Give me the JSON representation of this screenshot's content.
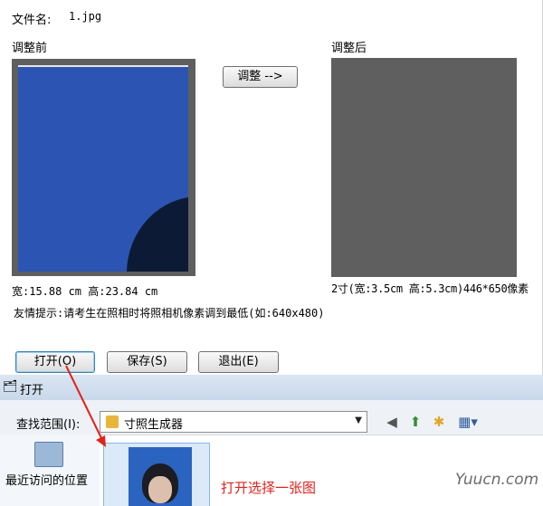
{
  "main": {
    "filename_label": "文件名:",
    "filename_value": "1.jpg",
    "before_label": "调整前",
    "after_label": "调整后",
    "adjust_button": "调整 -->",
    "before_size_text": "宽:15.88 cm 高:23.84 cm",
    "after_size_text": "2寸(宽:3.5cm 高:5.3cm)446*650像素",
    "tip_text": "友情提示:请考生在照相时将照相机像素调到最低(如:640x480)",
    "buttons": {
      "open": "打开(O)",
      "save": "保存(S)",
      "exit": "退出(E)"
    }
  },
  "dialog": {
    "title": "打开",
    "look_in_label": "查找范围(I):",
    "look_in_value": "寸照生成器",
    "places": {
      "recent": "最近访问的位置"
    }
  },
  "annotation": {
    "text": "打开选择一张图",
    "color": "#e0231c"
  },
  "watermark": "Yuucn.com",
  "icons": {
    "back": "back-arrow-icon",
    "up": "up-folder-icon",
    "new_folder": "new-folder-icon",
    "view_menu": "view-menu-icon"
  }
}
